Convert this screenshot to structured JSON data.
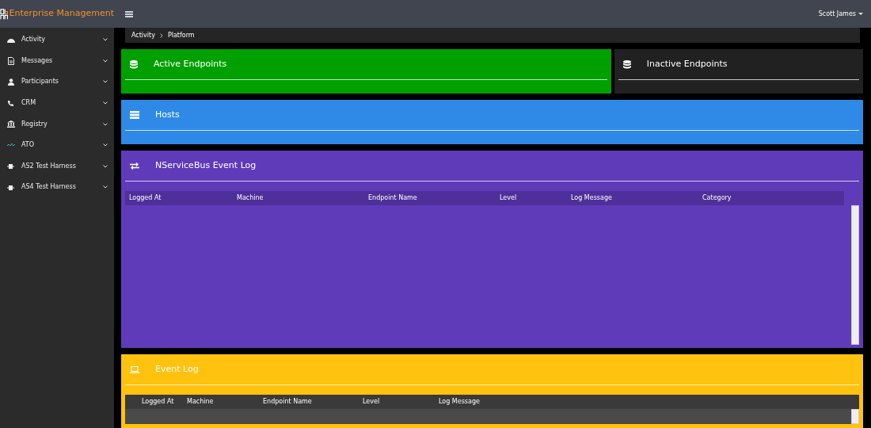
{
  "brand": {
    "title": "Enterprise Management"
  },
  "topbar": {
    "user": "Scott James"
  },
  "sidebar": {
    "items": [
      {
        "label": "Activity"
      },
      {
        "label": "Messages"
      },
      {
        "label": "Participants"
      },
      {
        "label": "CRM"
      },
      {
        "label": "Registry"
      },
      {
        "label": "ATO"
      },
      {
        "label": "AS2 Test Harness"
      },
      {
        "label": "AS4 Test Harness"
      }
    ]
  },
  "breadcrumb": [
    "Activity",
    "Platform"
  ],
  "panels": [
    {
      "title": "Active Endpoints",
      "color": "#00a000"
    },
    {
      "title": "Inactive Endpoints",
      "color": "#212121"
    },
    {
      "title": "Hosts",
      "color": "#2e8ae6"
    },
    {
      "title": "NServiceBus Event Log",
      "color": "#5f3bb9",
      "table": {
        "columns": [
          "Logged At",
          "Machine",
          "Endpoint Name",
          "Level",
          "Log Message",
          "Category"
        ]
      }
    },
    {
      "title": "Event Log",
      "color": "#ffc20e",
      "table": {
        "columns": [
          "Logged At",
          "Machine",
          "Endpoint Name",
          "Level",
          "Log Message"
        ]
      }
    }
  ]
}
